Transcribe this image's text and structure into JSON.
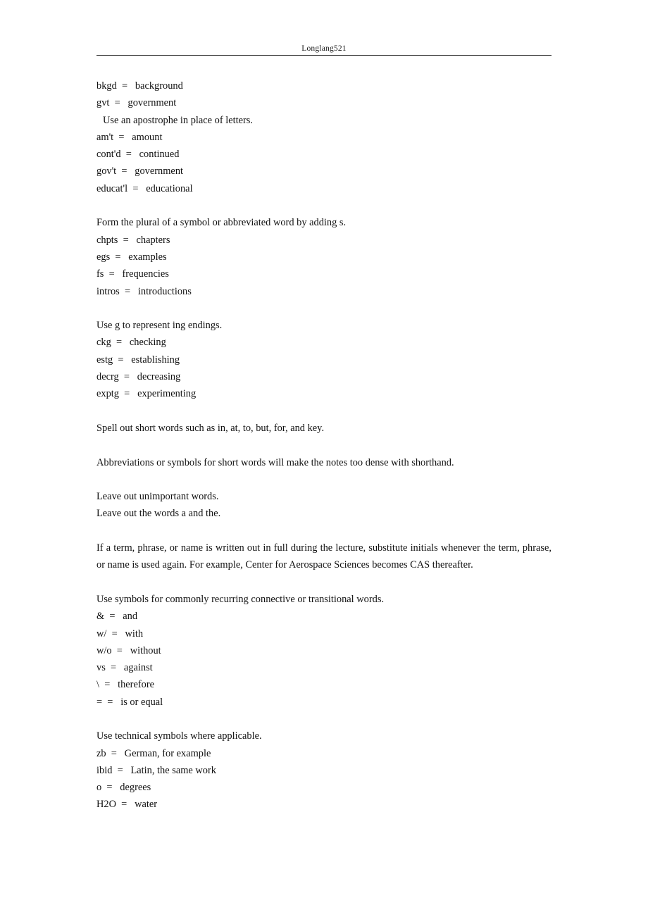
{
  "header": {
    "title": "Longlang521"
  },
  "document": {
    "blocks": [
      {
        "type": "list",
        "name": "abbreviation-list-initial",
        "lines": [
          "bkgd  =   background",
          "gvt  =   government"
        ]
      },
      {
        "type": "indented-line",
        "name": "apostrophe-rule",
        "text": "Use an apostrophe in place of letters."
      },
      {
        "type": "list",
        "name": "apostrophe-list",
        "lines": [
          "am't  =   amount",
          "cont'd  =   continued",
          "gov't  =   government",
          "educat'l  =   educational"
        ]
      },
      {
        "type": "rule-heading",
        "name": "plural-rule",
        "text": "Form the plural of a symbol or abbreviated word by adding s."
      },
      {
        "type": "list",
        "name": "plural-list",
        "lines": [
          "chpts  =   chapters",
          "egs  =   examples",
          "fs  =   frequencies",
          "intros  =   introductions"
        ]
      },
      {
        "type": "rule-heading",
        "name": "ing-rule",
        "text": "Use g to represent ing endings."
      },
      {
        "type": "list",
        "name": "ing-list",
        "lines": [
          "ckg  =   checking",
          "estg  =   establishing",
          "decrg  =   decreasing",
          "exptg  =   experimenting"
        ]
      },
      {
        "type": "paragraph",
        "name": "spell-out-paragraph",
        "text": "Spell out short words such as in, at, to, but, for, and key."
      },
      {
        "type": "paragraph",
        "name": "dense-shorthand-paragraph",
        "text": "Abbreviations or symbols for short words will make the notes too dense with shorthand."
      },
      {
        "type": "paragraph-group",
        "name": "leave-out-paragraph",
        "lines": [
          "Leave out unimportant words.",
          "Leave out the words a and the."
        ]
      },
      {
        "type": "paragraph-justified",
        "name": "initials-paragraph",
        "text": "If a term, phrase, or name is written out in full during the lecture, substitute initials whenever the term, phrase, or name is used again. For example, Center for Aerospace Sciences becomes CAS thereafter."
      },
      {
        "type": "rule-heading",
        "name": "connective-symbols-rule",
        "text": "Use symbols for commonly recurring connective or transitional words."
      },
      {
        "type": "list",
        "name": "connective-symbols-list",
        "lines": [
          "&  =   and",
          "w/  =   with",
          "w/o  =   without",
          "vs  =   against",
          "\\  =   therefore",
          "=  =   is or equal"
        ]
      },
      {
        "type": "rule-heading",
        "name": "technical-symbols-rule",
        "text": "Use technical symbols where applicable."
      },
      {
        "type": "list",
        "name": "technical-symbols-list",
        "lines": [
          "zb  =   German, for example",
          "ibid  =   Latin, the same work",
          "o  =   degrees",
          "H2O  =   water"
        ]
      }
    ]
  }
}
